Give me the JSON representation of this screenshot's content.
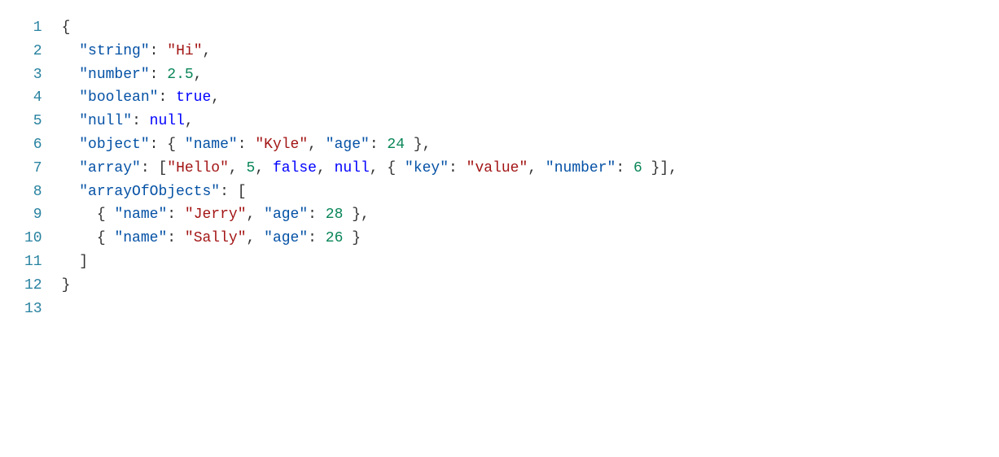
{
  "lineNumbers": [
    "1",
    "2",
    "3",
    "4",
    "5",
    "6",
    "7",
    "8",
    "9",
    "10",
    "11",
    "12",
    "13"
  ],
  "lines": {
    "l1": {
      "indent0": "{"
    },
    "l2": {
      "indent1": "  ",
      "q1": "\"",
      "keyString": "string",
      "q2": "\"",
      "colon": ": ",
      "q3": "\"",
      "valHi": "Hi",
      "q4": "\"",
      "comma": ","
    },
    "l3": {
      "indent1": "  ",
      "q1": "\"",
      "keyNumber": "number",
      "q2": "\"",
      "colon": ": ",
      "valNum": "2.5",
      "comma": ","
    },
    "l4": {
      "indent1": "  ",
      "q1": "\"",
      "keyBoolean": "boolean",
      "q2": "\"",
      "colon": ": ",
      "valTrue": "true",
      "comma": ","
    },
    "l5": {
      "indent1": "  ",
      "q1": "\"",
      "keyNull": "null",
      "q2": "\"",
      "colon": ": ",
      "valNull": "null",
      "comma": ","
    },
    "l6": {
      "indent1": "  ",
      "q1": "\"",
      "keyObject": "object",
      "q2": "\"",
      "colon": ": ",
      "lbrace": "{ ",
      "q3": "\"",
      "keyName": "name",
      "q4": "\"",
      "colon2": ": ",
      "q5": "\"",
      "valKyle": "Kyle",
      "q6": "\"",
      "comma2": ", ",
      "q7": "\"",
      "keyAge": "age",
      "q8": "\"",
      "colon3": ": ",
      "valAge": "24",
      "rbrace": " }",
      "comma": ","
    },
    "l7": {
      "indent1": "  ",
      "q1": "\"",
      "keyArray": "array",
      "q2": "\"",
      "colon": ": ",
      "lbracket": "[",
      "q3": "\"",
      "valHello": "Hello",
      "q4": "\"",
      "comma1": ", ",
      "val5": "5",
      "comma2": ", ",
      "valFalse": "false",
      "comma3": ", ",
      "valNull": "null",
      "comma4": ", ",
      "lbrace": "{ ",
      "q5": "\"",
      "keyKey": "key",
      "q6": "\"",
      "colon2": ": ",
      "q7": "\"",
      "valValue": "value",
      "q8": "\"",
      "comma5": ", ",
      "q9": "\"",
      "keyNum": "number",
      "q10": "\"",
      "colon3": ": ",
      "val6": "6",
      "rbrace": " }",
      "rbracket": "]",
      "comma": ","
    },
    "l8": {
      "indent1": "  ",
      "q1": "\"",
      "keyAOO": "arrayOfObjects",
      "q2": "\"",
      "colon": ": ",
      "lbracket": "["
    },
    "l9": {
      "indent2": "    ",
      "lbrace": "{ ",
      "q1": "\"",
      "keyName": "name",
      "q2": "\"",
      "colon": ": ",
      "q3": "\"",
      "valJerry": "Jerry",
      "q4": "\"",
      "comma1": ", ",
      "q5": "\"",
      "keyAge": "age",
      "q6": "\"",
      "colon2": ": ",
      "valAge": "28",
      "rbrace": " }",
      "comma": ","
    },
    "l10": {
      "indent2": "    ",
      "lbrace": "{ ",
      "q1": "\"",
      "keyName": "name",
      "q2": "\"",
      "colon": ": ",
      "q3": "\"",
      "valSally": "Sally",
      "q4": "\"",
      "comma1": ", ",
      "q5": "\"",
      "keyAge": "age",
      "q6": "\"",
      "colon2": ": ",
      "valAge": "26",
      "rbrace": " }"
    },
    "l11": {
      "indent1": "  ",
      "rbracket": "]"
    },
    "l12": {
      "indent0": "}"
    },
    "l13": {
      "blank": " "
    }
  }
}
